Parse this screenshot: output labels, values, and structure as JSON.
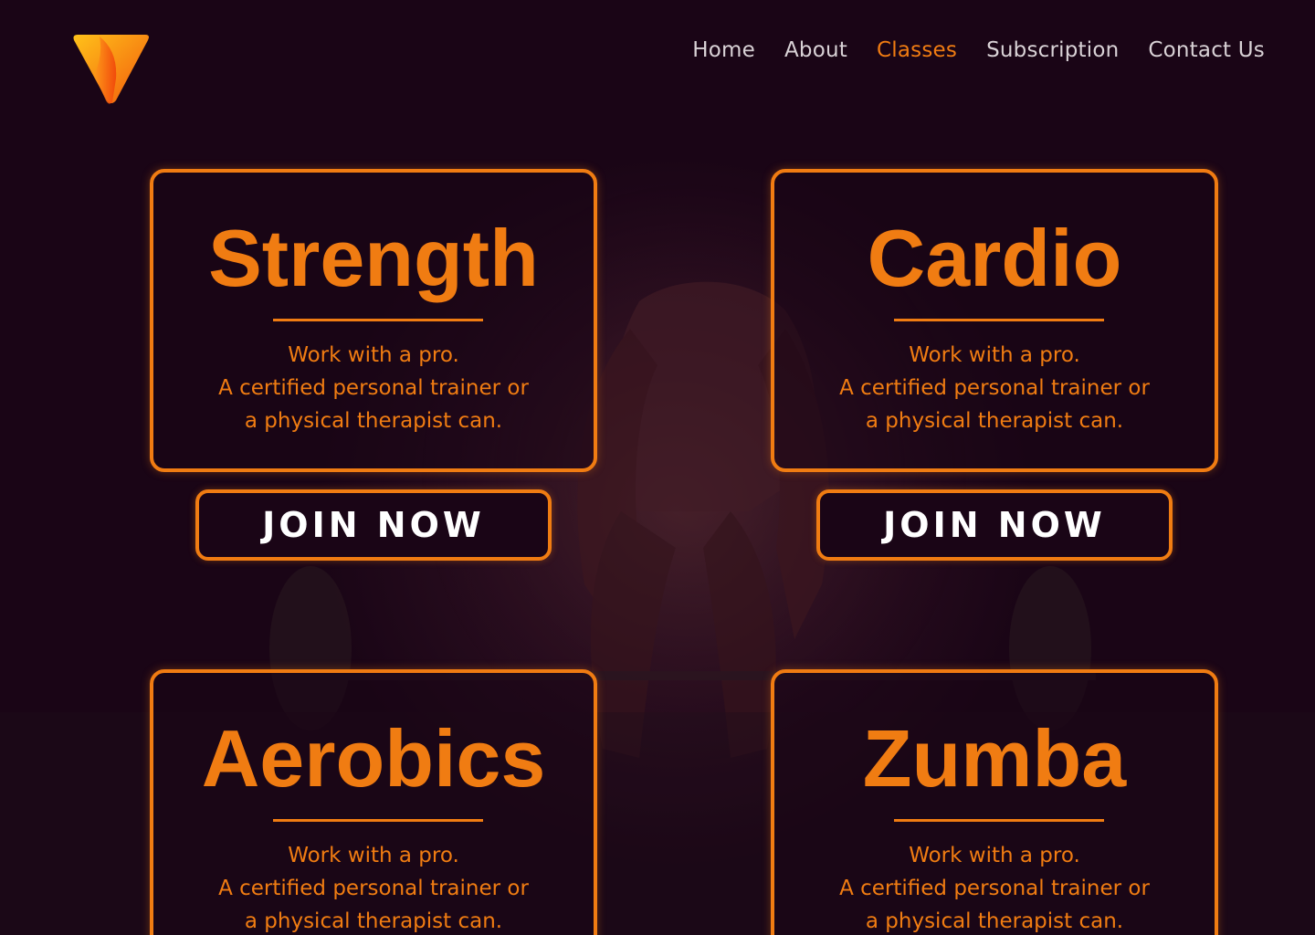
{
  "nav": {
    "items": [
      {
        "label": "Home",
        "active": false
      },
      {
        "label": "About",
        "active": false
      },
      {
        "label": "Classes",
        "active": true
      },
      {
        "label": "Subscription",
        "active": false
      },
      {
        "label": "Contact Us",
        "active": false
      }
    ]
  },
  "cards": [
    {
      "title": "Strength",
      "lines": [
        "Work with a pro.",
        "A certified personal trainer or",
        "a physical therapist can."
      ],
      "button": "JOIN NOW"
    },
    {
      "title": "Cardio",
      "lines": [
        "Work with a pro.",
        "A certified personal trainer or",
        "a physical therapist can."
      ],
      "button": "JOIN NOW"
    },
    {
      "title": "Aerobics",
      "lines": [
        "Work with a pro.",
        "A certified personal trainer or",
        "a physical therapist can."
      ]
    },
    {
      "title": "Zumba",
      "lines": [
        "Work with a pro.",
        "A certified personal trainer or",
        "a physical therapist can."
      ]
    }
  ],
  "colors": {
    "accent": "#f07c12",
    "background": "#1a0516",
    "nav_text": "#d9d2d6"
  },
  "icons": {
    "logo": "v-shield-logo-icon"
  }
}
